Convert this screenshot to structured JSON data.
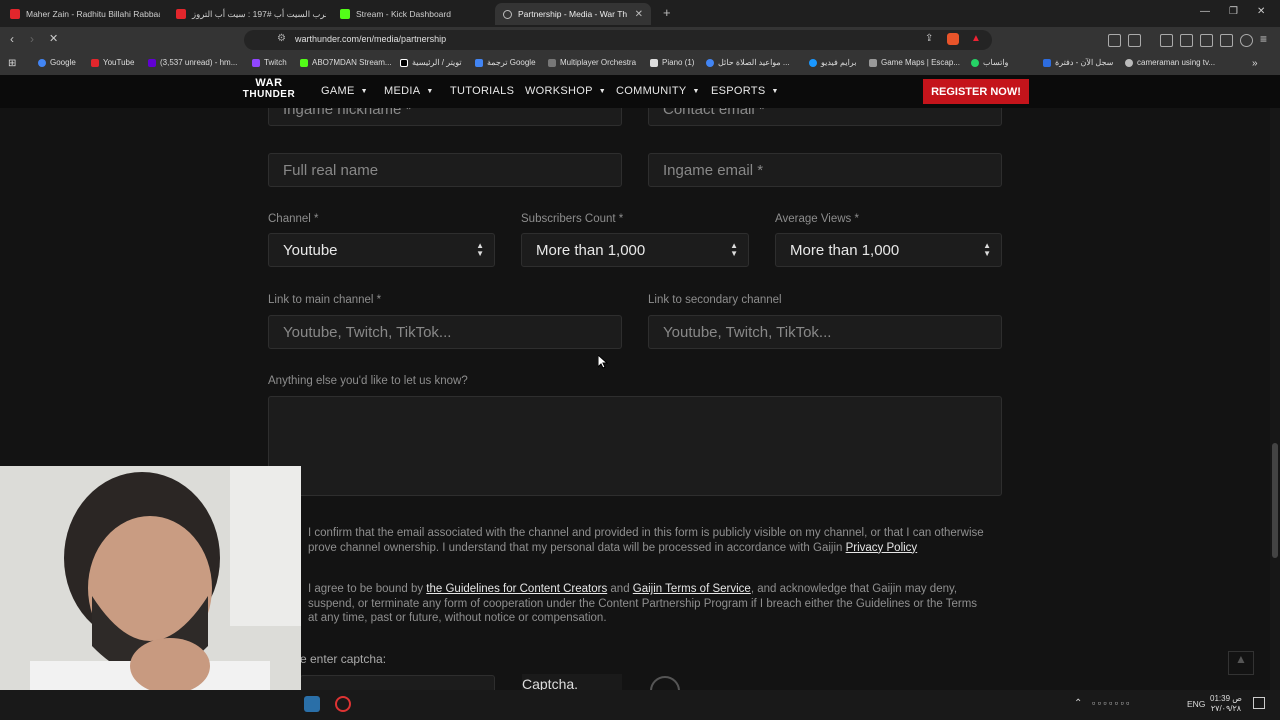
{
  "browser": {
    "tabs": [
      {
        "title": "Maher Zain - Radhitu Billahi Rabbaa",
        "color": "#e2262c"
      },
      {
        "title": "حرب السيت أب #197 : سيت أب التروز ..",
        "color": "#e2262c"
      },
      {
        "title": "Stream - Kick Dashboard",
        "color": "#53fc18"
      },
      {
        "title": "Partnership - Media - War Thunder",
        "color": "#888888"
      }
    ],
    "url": "warthunder.com/en/media/partnership",
    "bookmarks": [
      "Google",
      "YouTube",
      "(3,537 unread) - hm...",
      "Twitch",
      "ABO7MDAN Stream...",
      "تويتر / الرئيسية",
      "ترجمة Google",
      "Multiplayer Orchestra",
      "Piano (1)",
      "مواعيد الصلاة حائل ...",
      "برايم فيديو",
      "Game Maps | Escap...",
      "واتساب",
      "سجل الآن - دفترة",
      "cameraman using tv..."
    ]
  },
  "site": {
    "logo_line1": "WAR",
    "logo_line2": "THUNDER",
    "nav": [
      "GAME",
      "MEDIA",
      "TUTORIALS",
      "WORKSHOP",
      "COMMUNITY",
      "ESPORTS"
    ],
    "register": "REGISTER NOW!"
  },
  "form": {
    "ingame_nickname": "Ingame nickname *",
    "contact_email": "Contact email *",
    "full_real_name": "Full real name",
    "ingame_email": "Ingame email *",
    "channel_label": "Channel *",
    "channel_value": "Youtube",
    "subscribers_label": "Subscribers Count *",
    "subscribers_value": "More than 1,000",
    "views_label": "Average Views *",
    "views_value": "More than 1,000",
    "main_link_label": "Link to main channel *",
    "main_link_placeholder": "Youtube, Twitch, TikTok...",
    "secondary_link_label": "Link to secondary channel",
    "secondary_link_placeholder": "Youtube, Twitch, TikTok...",
    "anything_label": "Anything else you'd like to let us know?",
    "confirm_text_a": "I confirm that the email associated with the channel and provided in this form is publicly visible on my channel, or that I can otherwise prove channel ownership. I understand that my personal data will be processed in accordance with Gaijin ",
    "privacy_link": "Privacy Policy",
    "agree_text_a": "I agree to be bound by ",
    "guidelines_link": "the Guidelines for Content Creators",
    "agree_and": " and ",
    "tos_link": "Gaijin Terms of Service",
    "agree_text_b": ", and acknowledge that Gaijin may deny, suspend, or terminate any form of cooperation under the Content Partnership Program if I breach either the Guidelines or the Terms at any time, past or future, without notice or compensation.",
    "captcha_label": "e enter captcha:",
    "captcha_alt": "Captcha."
  },
  "taskbar": {
    "time": "01:39 ص",
    "date": "٢٧/٠٩/٢٨",
    "lang": "ENG"
  }
}
